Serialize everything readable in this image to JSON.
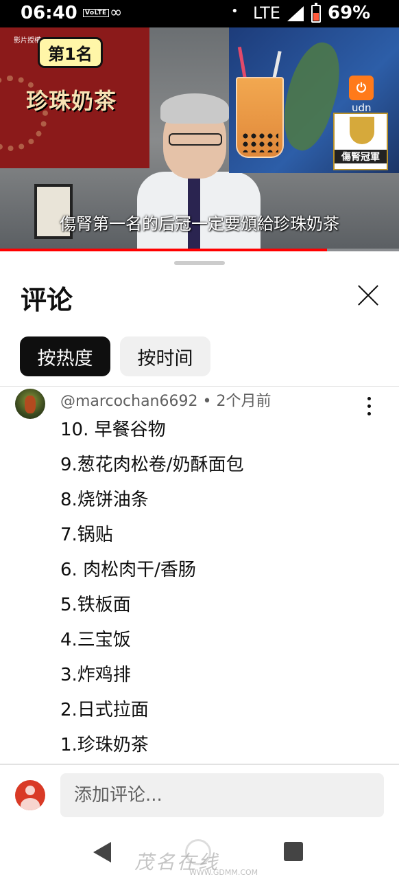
{
  "status_bar": {
    "time": "06:40",
    "volte": "VoLTE",
    "network": "LTE",
    "battery": "69%"
  },
  "video": {
    "credit": "影片授權",
    "badge": "第1名",
    "title_overlay": "珍珠奶茶",
    "udn_label": "udn",
    "trophy_label": "傷腎冠軍",
    "subtitle": "傷腎第一名的后冠一定要頒給珍珠奶茶",
    "progress": 0.82
  },
  "sheet": {
    "title": "评论",
    "sort_tabs": [
      {
        "label": "按热度",
        "active": true
      },
      {
        "label": "按时间",
        "active": false
      }
    ]
  },
  "comment": {
    "author_line": "@marcochan6692 • 2个月前",
    "lines": [
      "10. 早餐谷物",
      "9.葱花肉松卷/奶酥面包",
      "8.烧饼油条",
      "7.锅贴",
      "6. 肉松肉干/香肠",
      "5.铁板面",
      "4.三宝饭",
      "3.炸鸡排",
      "2.日式拉面",
      "1.珍珠奶茶"
    ]
  },
  "add_comment": {
    "placeholder": "添加评论..."
  },
  "watermark": {
    "main": "茂名在线",
    "sub": "WWW.GDMM.COM"
  }
}
